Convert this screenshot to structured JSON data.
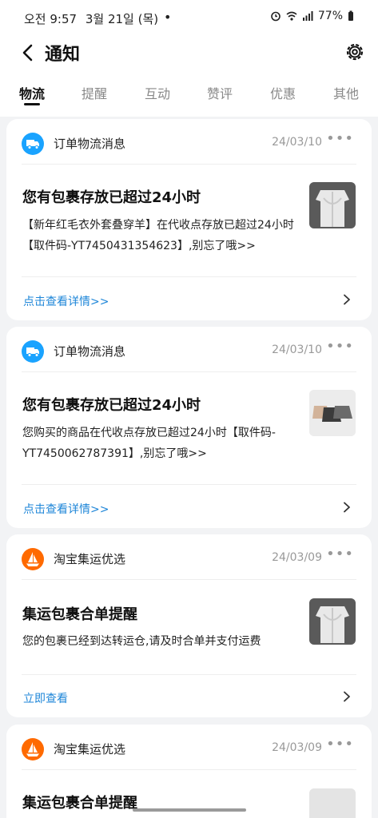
{
  "status_bar": {
    "time": "오전 9:57",
    "date": "3월 21일 (목)",
    "dot": "•",
    "battery": "77%"
  },
  "header": {
    "title": "通知"
  },
  "tabs": [
    {
      "label": "物流",
      "active": true
    },
    {
      "label": "提醒",
      "active": false
    },
    {
      "label": "互动",
      "active": false
    },
    {
      "label": "赞评",
      "active": false
    },
    {
      "label": "优惠",
      "active": false
    },
    {
      "label": "其他",
      "active": false
    }
  ],
  "cards": [
    {
      "icon": "truck-icon",
      "source": "订单物流消息",
      "date": "24/03/10",
      "more": "•••",
      "title": "您有包裹存放已超过24小时",
      "body": "【新年红毛衣外套叠穿羊】在代收点存放已超过24小时【取件码-YT7450431354623】,别忘了哦>>",
      "link": "点击查看详情>>",
      "thumb": "sweater"
    },
    {
      "icon": "truck-icon",
      "source": "订单物流消息",
      "date": "24/03/10",
      "more": "•••",
      "title": "您有包裹存放已超过24小时",
      "body": "您购买的商品在代收点存放已超过24小时【取件码-YT7450062787391】,别忘了哦>>",
      "link": "点击查看详情>>",
      "thumb": "skirts"
    },
    {
      "icon": "boat-icon",
      "source": "淘宝集运优选",
      "date": "24/03/09",
      "more": "•••",
      "title": "集运包裹合单提醒",
      "body": "您的包裹已经到达转运仓,请及时合单并支付运费",
      "link": "立即查看",
      "thumb": "sweater"
    },
    {
      "icon": "boat-icon",
      "source": "淘宝集运优选",
      "date": "24/03/09",
      "more": "•••",
      "title": "集运包裹合单提醒",
      "body": "",
      "link": "",
      "thumb": "partial"
    }
  ],
  "colors": {
    "accent_link": "#1e86d8",
    "truck_icon_bg": "#1aa3ff",
    "boat_icon_bg": "#ff6a00",
    "page_bg": "#f2f3f5"
  }
}
